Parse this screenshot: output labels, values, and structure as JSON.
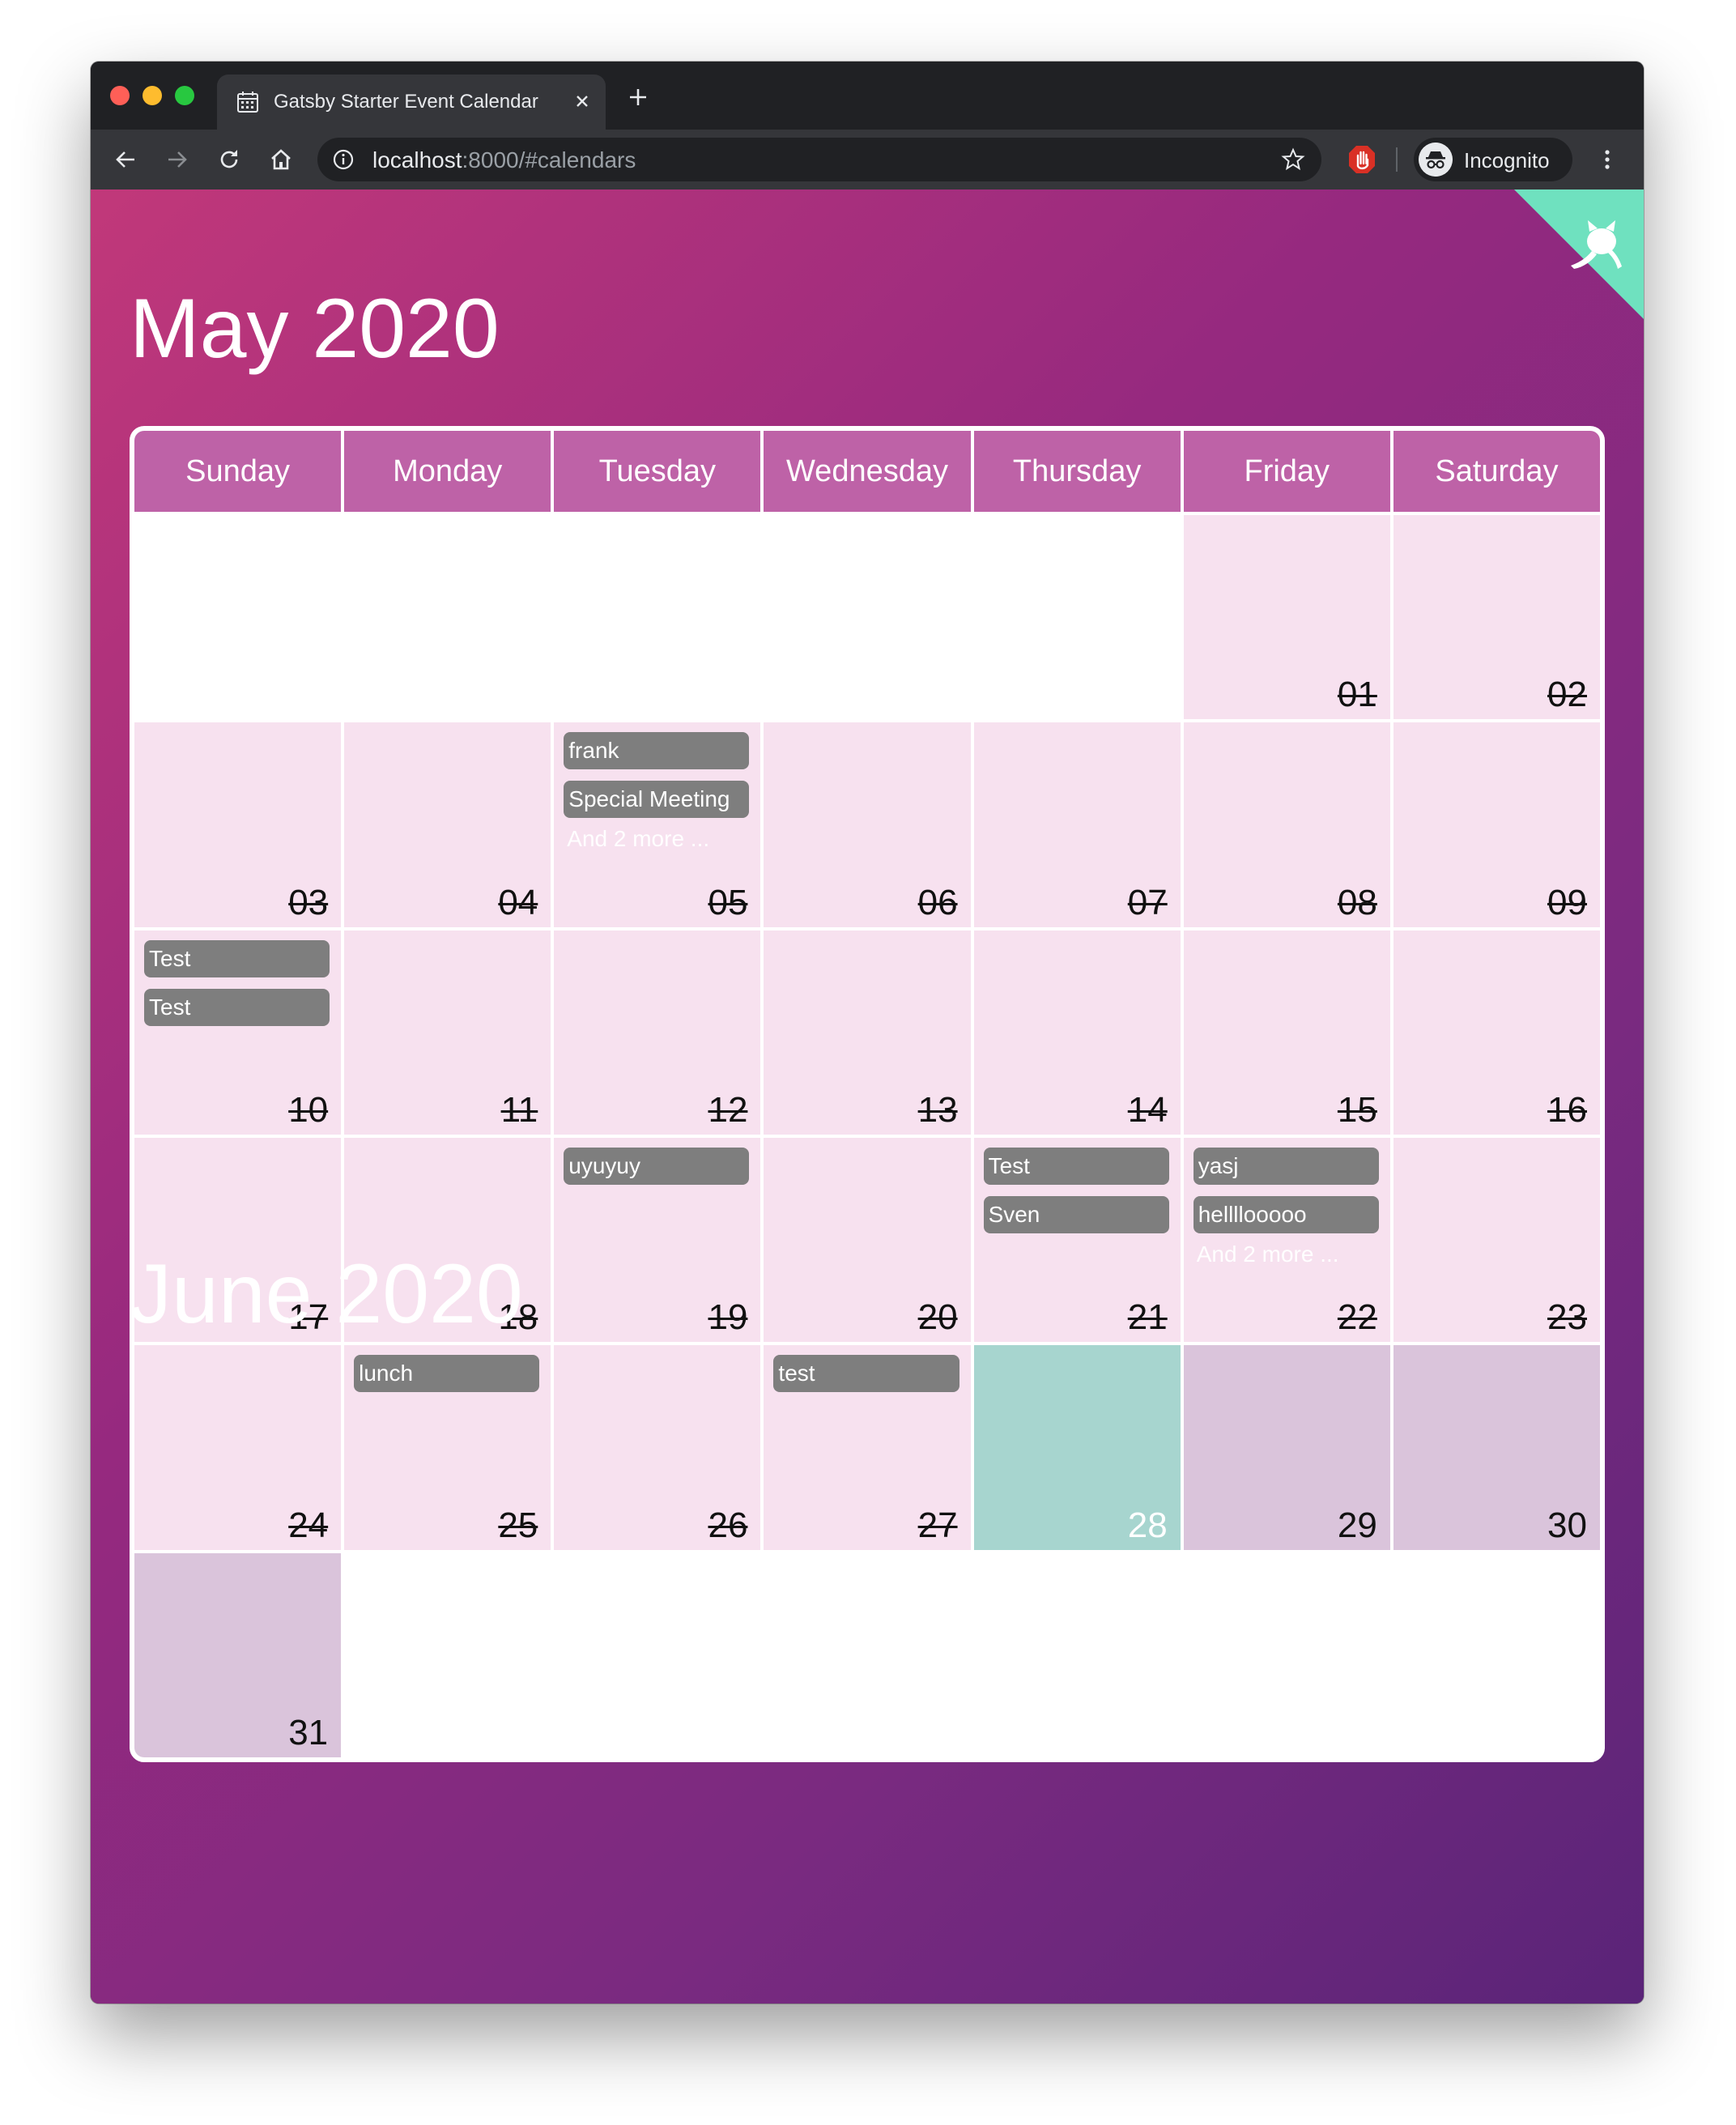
{
  "browser": {
    "tab": {
      "title": "Gatsby Starter Event Calendar",
      "icon": "calendar-icon"
    },
    "url_host": "localhost",
    "url_rest": ":8000/#calendars",
    "profile_label": "Incognito"
  },
  "colors": {
    "page_gradient": [
      "#c1387a",
      "#96297f",
      "#5a2478"
    ],
    "today": "#a7d5cf",
    "event_pill": "#7e7e7e",
    "github_corner": "#6fe1bf"
  },
  "calendar": {
    "month_title": "May 2020",
    "weekdays": [
      "Sunday",
      "Monday",
      "Tuesday",
      "Wednesday",
      "Thursday",
      "Friday",
      "Saturday"
    ],
    "days": [
      {
        "num": "",
        "state": "empty",
        "events": [],
        "more": ""
      },
      {
        "num": "",
        "state": "empty",
        "events": [],
        "more": ""
      },
      {
        "num": "",
        "state": "empty",
        "events": [],
        "more": ""
      },
      {
        "num": "",
        "state": "empty",
        "events": [],
        "more": ""
      },
      {
        "num": "",
        "state": "empty",
        "events": [],
        "more": ""
      },
      {
        "num": "01",
        "state": "past",
        "events": [],
        "more": ""
      },
      {
        "num": "02",
        "state": "past",
        "events": [],
        "more": ""
      },
      {
        "num": "03",
        "state": "past",
        "events": [],
        "more": ""
      },
      {
        "num": "04",
        "state": "past",
        "events": [],
        "more": ""
      },
      {
        "num": "05",
        "state": "past",
        "events": [
          "frank",
          "Special Meeting"
        ],
        "more": "And 2 more ..."
      },
      {
        "num": "06",
        "state": "past",
        "events": [],
        "more": ""
      },
      {
        "num": "07",
        "state": "past",
        "events": [],
        "more": ""
      },
      {
        "num": "08",
        "state": "past",
        "events": [],
        "more": ""
      },
      {
        "num": "09",
        "state": "past",
        "events": [],
        "more": ""
      },
      {
        "num": "10",
        "state": "past",
        "events": [
          "Test",
          "Test"
        ],
        "more": ""
      },
      {
        "num": "11",
        "state": "past",
        "events": [],
        "more": ""
      },
      {
        "num": "12",
        "state": "past",
        "events": [],
        "more": ""
      },
      {
        "num": "13",
        "state": "past",
        "events": [],
        "more": ""
      },
      {
        "num": "14",
        "state": "past",
        "events": [],
        "more": ""
      },
      {
        "num": "15",
        "state": "past",
        "events": [],
        "more": ""
      },
      {
        "num": "16",
        "state": "past",
        "events": [],
        "more": ""
      },
      {
        "num": "17",
        "state": "past",
        "events": [],
        "more": ""
      },
      {
        "num": "18",
        "state": "past",
        "events": [],
        "more": ""
      },
      {
        "num": "19",
        "state": "past",
        "events": [
          "uyuyuy"
        ],
        "more": ""
      },
      {
        "num": "20",
        "state": "past",
        "events": [],
        "more": ""
      },
      {
        "num": "21",
        "state": "past",
        "events": [
          "Test",
          "Sven"
        ],
        "more": ""
      },
      {
        "num": "22",
        "state": "past",
        "events": [
          "yasj",
          "hellllooooo"
        ],
        "more": "And 2 more ..."
      },
      {
        "num": "23",
        "state": "past",
        "events": [],
        "more": ""
      },
      {
        "num": "24",
        "state": "past",
        "events": [],
        "more": ""
      },
      {
        "num": "25",
        "state": "past",
        "events": [
          "lunch"
        ],
        "more": ""
      },
      {
        "num": "26",
        "state": "past",
        "events": [],
        "more": ""
      },
      {
        "num": "27",
        "state": "past",
        "events": [
          "test"
        ],
        "more": ""
      },
      {
        "num": "28",
        "state": "today",
        "events": [],
        "more": ""
      },
      {
        "num": "29",
        "state": "future",
        "events": [],
        "more": ""
      },
      {
        "num": "30",
        "state": "future",
        "events": [],
        "more": ""
      },
      {
        "num": "31",
        "state": "future",
        "events": [],
        "more": ""
      },
      {
        "num": "",
        "state": "empty",
        "events": [],
        "more": ""
      },
      {
        "num": "",
        "state": "empty",
        "events": [],
        "more": ""
      },
      {
        "num": "",
        "state": "empty",
        "events": [],
        "more": ""
      },
      {
        "num": "",
        "state": "empty",
        "events": [],
        "more": ""
      },
      {
        "num": "",
        "state": "empty",
        "events": [],
        "more": ""
      },
      {
        "num": "",
        "state": "empty",
        "events": [],
        "more": ""
      }
    ]
  },
  "next_month_title": "June 2020"
}
